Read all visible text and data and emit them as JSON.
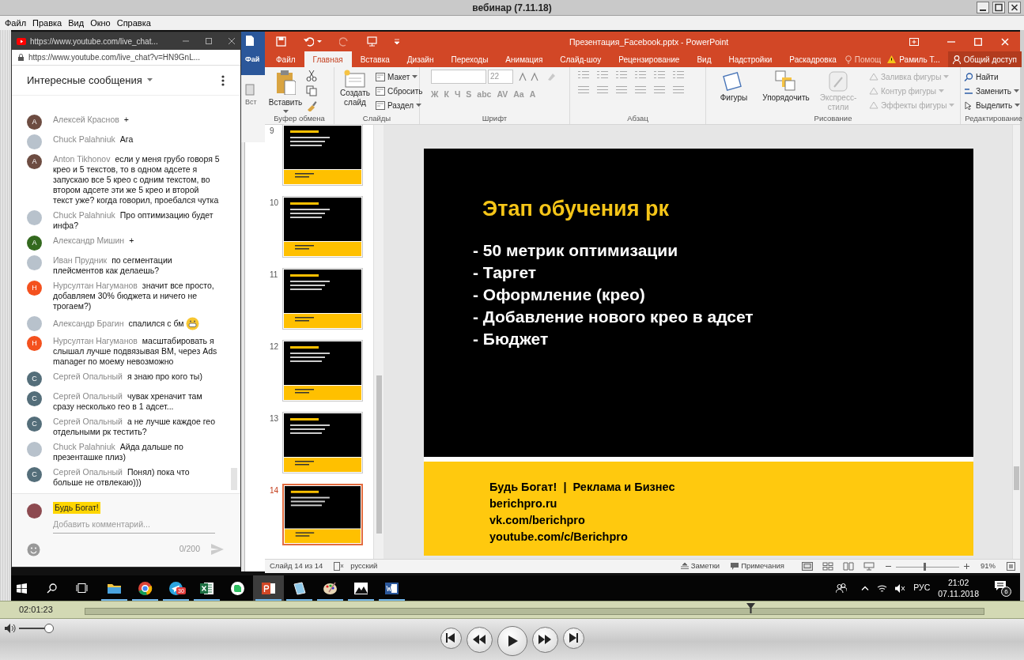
{
  "player": {
    "title": "вебинар (7.11.18)",
    "menu": [
      "Файл",
      "Правка",
      "Вид",
      "Окно",
      "Справка"
    ],
    "time": "02:01:23",
    "position": {
      "level": 0.74
    },
    "volume": {
      "level": 0.95
    }
  },
  "chat": {
    "tab_title": "https://www.youtube.com/live_chat...",
    "url": "https://www.youtube.com/live_chat?v=HN9GnL...",
    "header": "Интересные сообщения",
    "messages": [
      {
        "author": "Алексей Краснов",
        "text": "+",
        "avatar": {
          "kind": "letter",
          "letter": "А",
          "color": "#6d4c41"
        }
      },
      {
        "author": "Chuck Palahniuk",
        "text": "Ага",
        "avatar": {
          "kind": "photo"
        }
      },
      {
        "author": "Anton Tikhonov",
        "text": "если у меня грубо говоря 5 крео и 5 текстов, то в одном адсете я запускаю все 5 крео с одним текстом, во втором адсете эти же 5 крео и второй текст уже? когда говорил, проебался чутка",
        "avatar": {
          "kind": "letter",
          "letter": "A",
          "color": "#6d4c41"
        }
      },
      {
        "author": "Chuck Palahniuk",
        "text": "Про оптимизацию будет инфа?",
        "avatar": {
          "kind": "photo"
        }
      },
      {
        "author": "Александр Мишин",
        "text": "+",
        "avatar": {
          "kind": "letter",
          "letter": "А",
          "color": "#33691e"
        }
      },
      {
        "author": "Иван Прудник",
        "text": "по сегментации плейсментов как делаешь?",
        "avatar": {
          "kind": "photo"
        }
      },
      {
        "author": "Нурсултан Нагуманов",
        "text": "значит все просто, добавляем 30% бюджета и ничего не трогаем?)",
        "avatar": {
          "kind": "letter",
          "letter": "Н",
          "color": "#f4511e"
        }
      },
      {
        "author": "Александр Брагин",
        "text": "спалился с бм",
        "emoji": true,
        "avatar": {
          "kind": "photo"
        }
      },
      {
        "author": "Нурсултан Нагуманов",
        "text": "масштабировать я слышал лучше подвязывая ВМ, через Ads manager по моему невозможно",
        "avatar": {
          "kind": "letter",
          "letter": "Н",
          "color": "#f4511e"
        }
      },
      {
        "author": "Сергей Опальный",
        "text": "я знаю про кого ты)",
        "avatar": {
          "kind": "letter",
          "letter": "С",
          "color": "#546e7a"
        }
      },
      {
        "author": "Сергей Опальный",
        "text": "чувак хреначит там сразу несколько гео в 1 адсет...",
        "avatar": {
          "kind": "letter",
          "letter": "С",
          "color": "#546e7a"
        }
      },
      {
        "author": "Сергей Опальный",
        "text": "а не лучше каждое гео отдельными рк тестить?",
        "avatar": {
          "kind": "letter",
          "letter": "С",
          "color": "#546e7a"
        }
      },
      {
        "author": "Chuck Palahniuk",
        "text": "Айда дальше по презенташке плиз)",
        "avatar": {
          "kind": "photo"
        }
      },
      {
        "author": "Сергей Опальный",
        "text": "Понял) пока что больше не отвлекаю)))",
        "avatar": {
          "kind": "letter",
          "letter": "С",
          "color": "#546e7a"
        }
      }
    ],
    "composer": {
      "author_chip": "Будь Богат!",
      "placeholder": "Добавить комментарий...",
      "counter": "0/200"
    }
  },
  "word_window": {
    "tab": "Фай",
    "command": "Вст"
  },
  "powerpoint": {
    "title": "Презентация_Facebook.pptx - PowerPoint",
    "tabs": [
      {
        "label": "Файл",
        "selected": false
      },
      {
        "label": "Главная",
        "selected": true
      },
      {
        "label": "Вставка",
        "selected": false
      },
      {
        "label": "Дизайн",
        "selected": false
      },
      {
        "label": "Переходы",
        "selected": false
      },
      {
        "label": "Анимация",
        "selected": false
      },
      {
        "label": "Слайд-шоу",
        "selected": false
      },
      {
        "label": "Рецензирование",
        "selected": false
      },
      {
        "label": "Вид",
        "selected": false
      },
      {
        "label": "Надстройки",
        "selected": false
      },
      {
        "label": "Раскадровка",
        "selected": false
      }
    ],
    "tell_me": "Помощ",
    "user": "Рамиль Т...",
    "share": "Общий доступ",
    "ribbon": {
      "clipboard": {
        "label": "Буфер обмена",
        "paste": "Вставить"
      },
      "slides": {
        "label": "Слайды",
        "new_slide": "Создать слайд",
        "commands": [
          {
            "label": "Макет",
            "dropdown": true
          },
          {
            "label": "Сбросить",
            "dropdown": false
          },
          {
            "label": "Раздел",
            "dropdown": true
          }
        ]
      },
      "font": {
        "label": "Шрифт",
        "size": "22",
        "formats": [
          "Ж",
          "К",
          "Ч",
          "S",
          "abc",
          "AV",
          "Aa",
          "A"
        ]
      },
      "paragraph": {
        "label": "Абзац"
      },
      "drawing": {
        "label": "Рисование",
        "tools": [
          {
            "label": "Фигуры",
            "disabled": false
          },
          {
            "label": "Упорядочить",
            "disabled": false
          },
          {
            "label": "Экспресс-стили",
            "disabled": true
          }
        ],
        "styles": [
          {
            "label": "Заливка фигуры",
            "disabled": true
          },
          {
            "label": "Контур фигуры",
            "disabled": true
          },
          {
            "label": "Эффекты фигуры",
            "disabled": true
          }
        ]
      },
      "editing": {
        "label": "Редактирование",
        "commands": [
          {
            "label": "Найти",
            "dropdown": false
          },
          {
            "label": "Заменить",
            "dropdown": true
          },
          {
            "label": "Выделить",
            "dropdown": true
          }
        ]
      }
    },
    "thumbnails": [
      {
        "number": "9",
        "selected": false
      },
      {
        "number": "10",
        "selected": false
      },
      {
        "number": "11",
        "selected": false
      },
      {
        "number": "12",
        "selected": false
      },
      {
        "number": "13",
        "selected": false
      },
      {
        "number": "14",
        "selected": true
      }
    ],
    "slide": {
      "title": "Этап обучения рк",
      "bullets": [
        "- 50 метрик оптимизации",
        "- Таргет",
        "- Оформление (крео)",
        "- Добавление нового крео в адсет",
        "- Бюджет"
      ],
      "footer": [
        "Будь Богат!  |  Реклама и Бизнес",
        "berichpro.ru",
        "vk.com/berichpro",
        "youtube.com/c/Berichpro"
      ]
    },
    "status_bar": {
      "slide_info": "Слайд 14 из 14",
      "language": "русский",
      "notes": "Заметки",
      "comments": "Примечания",
      "zoom": {
        "level": 0.45
      },
      "zoom_text": "91%"
    }
  },
  "taskbar": {
    "apps": [
      {
        "kind": "folder",
        "selected": false,
        "running": true
      },
      {
        "kind": "chrome",
        "selected": false,
        "running": true
      },
      {
        "kind": "telegram",
        "selected": false,
        "running": true,
        "badge": "30"
      },
      {
        "kind": "excel",
        "selected": false,
        "running": true
      },
      {
        "kind": "evernote",
        "selected": false,
        "running": false
      },
      {
        "kind": "powerpoint",
        "selected": true,
        "running": true
      },
      {
        "kind": "notepad",
        "selected": false,
        "running": true
      },
      {
        "kind": "paint",
        "selected": false,
        "running": true
      },
      {
        "kind": "photos",
        "selected": false,
        "running": true
      },
      {
        "kind": "word",
        "selected": false,
        "running": true
      }
    ],
    "language": "РУС",
    "time": "21:02",
    "date": "07.11.2018",
    "notifications": "6"
  }
}
